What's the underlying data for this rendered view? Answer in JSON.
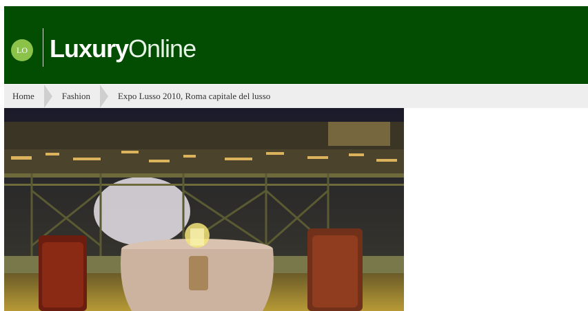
{
  "brand": {
    "badge": "LO",
    "name_bold": "Luxury",
    "name_light": "Online"
  },
  "breadcrumb": [
    {
      "label": "Home"
    },
    {
      "label": "Fashion"
    },
    {
      "label": "Expo Lusso 2010, Roma capitale del lusso"
    }
  ],
  "hero": {
    "icon": "photo-terrace-night-rome"
  }
}
